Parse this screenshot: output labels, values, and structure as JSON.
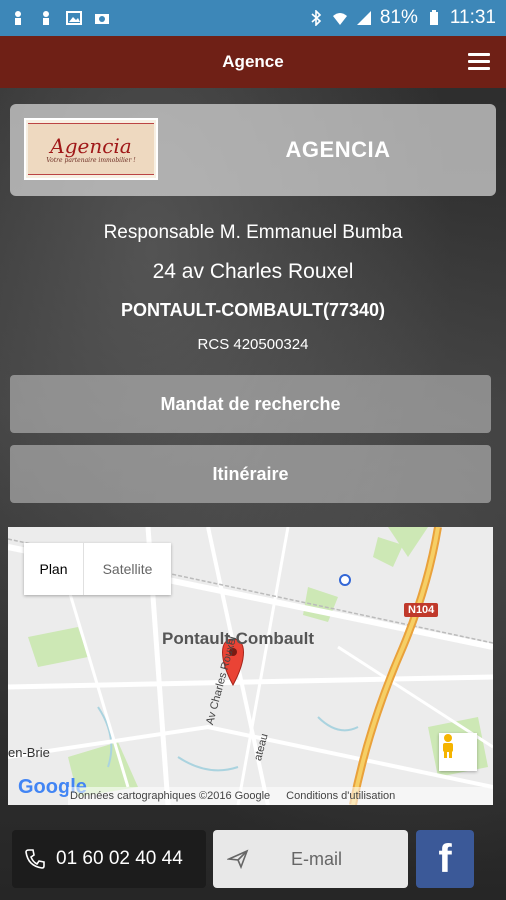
{
  "status_bar": {
    "battery": "81%",
    "time": "11:31"
  },
  "app_bar": {
    "title": "Agence"
  },
  "agency": {
    "logo_title": "Agencia",
    "logo_tagline": "Votre partenaire immobilier !",
    "name": "AGENCIA",
    "responsible": "Responsable M. Emmanuel Bumba",
    "address": "24 av Charles Rouxel",
    "city": "PONTAULT-COMBAULT(77340)",
    "rcs": "RCS 420500324"
  },
  "buttons": {
    "mandat": "Mandat de recherche",
    "itineraire": "Itinéraire"
  },
  "map": {
    "type_plan": "Plan",
    "type_satellite": "Satellite",
    "city_label": "Pontault-Combault",
    "street_label": "Av Charles Rouxel",
    "street_label_2": "ateau",
    "left_label": "en-Brie",
    "road_badge": "N104",
    "footer_data": "Données cartographiques ©2016 Google",
    "footer_terms": "Conditions d'utilisation",
    "google": "Google"
  },
  "contact": {
    "phone": "01 60 02 40 44",
    "email": "E-mail",
    "facebook": "f"
  },
  "colors": {
    "status_bar": "#3d87b8",
    "app_bar": "#6f2016",
    "facebook": "#3b5998"
  },
  "icons": [
    "menu-icon",
    "phone-icon",
    "send-icon",
    "facebook-icon",
    "pegman-icon",
    "map-pin-icon"
  ]
}
